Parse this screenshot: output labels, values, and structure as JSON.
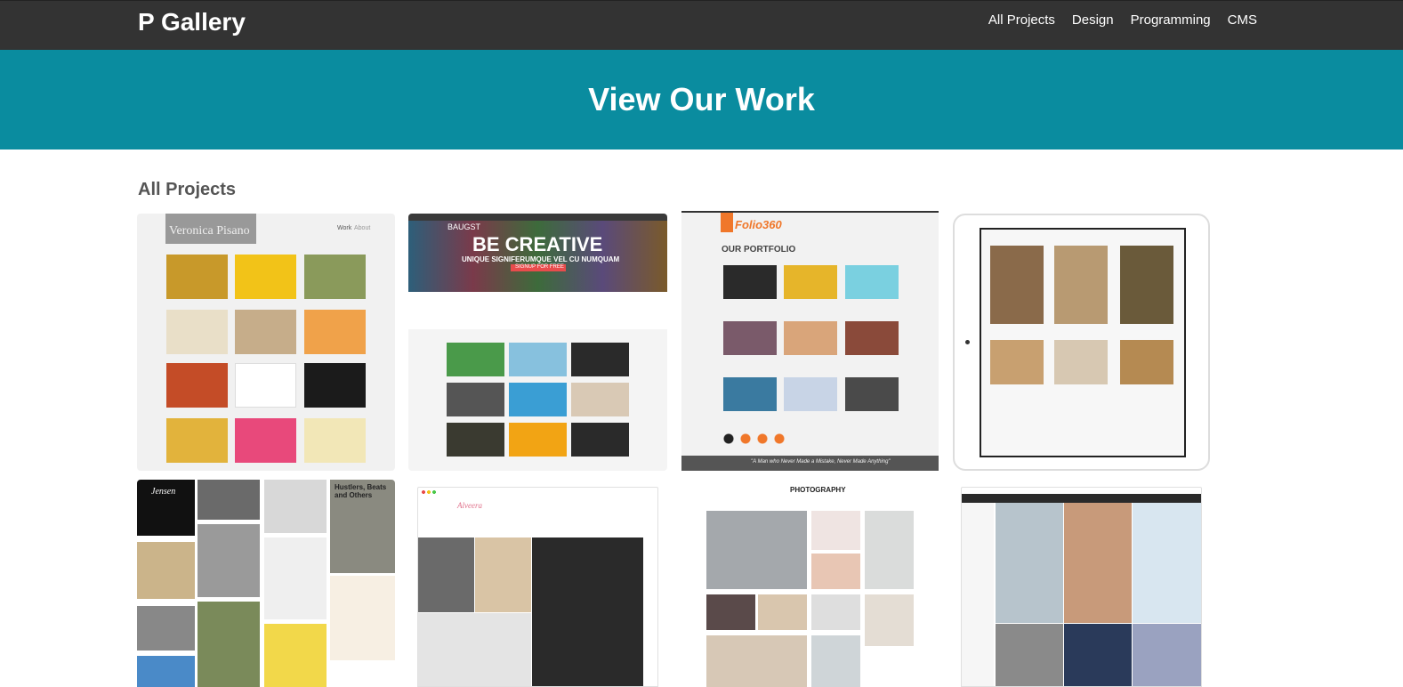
{
  "navbar": {
    "brand": "P Gallery",
    "links": [
      "All Projects",
      "Design",
      "Programming",
      "CMS"
    ]
  },
  "hero": {
    "title": "View Our Work"
  },
  "section": {
    "title": "All Projects"
  },
  "thumbs": {
    "t1": {
      "name": "Veronica Pisano",
      "nav1": "Work",
      "nav2": "About"
    },
    "t2": {
      "brand": "BAUGST",
      "headline": "BE CREATIVE",
      "tagline": "UNIQUE SIGNIFERUMQUE VEL CU NUMQUAM",
      "cta": "SIGNUP FOR FREE"
    },
    "t3": {
      "brand": "Folio360",
      "heading": "OUR PORTFOLIO",
      "quote": "\"A Man who Never Made a Mistake, Never Made Anything\""
    },
    "t5": {
      "brand": "Jensen",
      "poster": "Hustlers, Beats and Others"
    },
    "t6": {
      "brand": "Alveera"
    },
    "t7": {
      "heading": "PHOTOGRAPHY"
    }
  },
  "colors": {
    "navbar": "#333333",
    "hero": "#0a8c9f",
    "title": "#555555"
  }
}
